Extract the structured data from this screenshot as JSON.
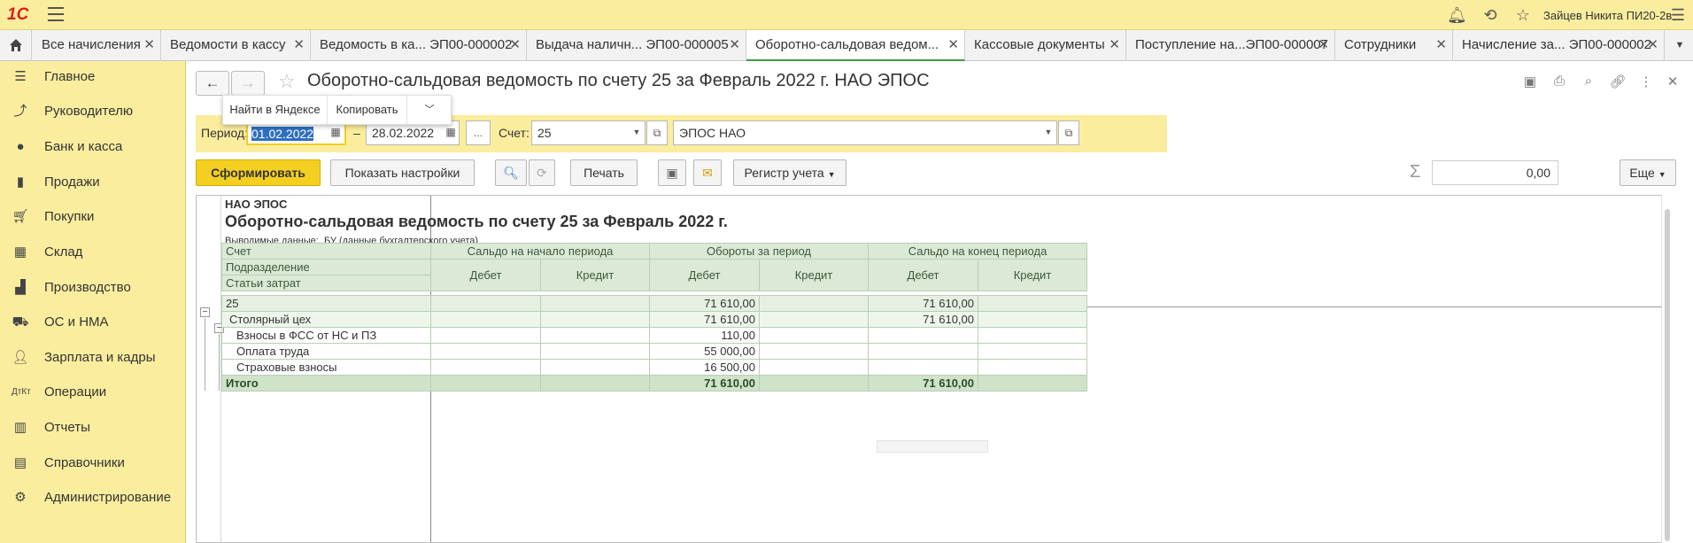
{
  "topbar": {
    "logo": "1С",
    "user": "Зайцев Никита ПИ20-2в"
  },
  "tabs": [
    {
      "label": "Все начисления"
    },
    {
      "label": "Ведомости в кассу"
    },
    {
      "label": "Ведомость в ка... ЭП00-000002"
    },
    {
      "label": "Выдача наличн... ЭП00-000005"
    },
    {
      "label": "Оборотно-сальдовая ведом..."
    },
    {
      "label": "Кассовые документы"
    },
    {
      "label": "Поступление на...ЭП00-000007"
    },
    {
      "label": "Сотрудники"
    },
    {
      "label": "Начисление за... ЭП00-000002"
    }
  ],
  "sidebar": {
    "items": [
      {
        "label": "Главное",
        "icon": "menu-icon"
      },
      {
        "label": "Руководителю",
        "icon": "trend-icon"
      },
      {
        "label": "Банк и касса",
        "icon": "coin-icon"
      },
      {
        "label": "Продажи",
        "icon": "bag-icon"
      },
      {
        "label": "Покупки",
        "icon": "cart-icon"
      },
      {
        "label": "Склад",
        "icon": "grid-icon"
      },
      {
        "label": "Производство",
        "icon": "factory-icon"
      },
      {
        "label": "ОС и НМА",
        "icon": "truck-icon"
      },
      {
        "label": "Зарплата и кадры",
        "icon": "person-icon"
      },
      {
        "label": "Операции",
        "icon": "dtkt-icon"
      },
      {
        "label": "Отчеты",
        "icon": "bar-chart-icon"
      },
      {
        "label": "Справочники",
        "icon": "books-icon"
      },
      {
        "label": "Администрирование",
        "icon": "gear-icon"
      }
    ]
  },
  "header": {
    "title": "Оборотно-сальдовая ведомость по счету 25 за Февраль 2022 г. НАО ЭПОС"
  },
  "popup": {
    "find": "Найти в Яндексе",
    "copy": "Копировать"
  },
  "filters": {
    "period_label": "Период:",
    "date_from": "01.02.2022",
    "dash": "–",
    "date_to": "28.02.2022",
    "dots": "...",
    "account_label": "Счет:",
    "account": "25",
    "org": "ЭПОС НАО"
  },
  "toolbar": {
    "generate": "Сформировать",
    "show_settings": "Показать настройки",
    "print": "Печать",
    "register": "Регистр учета",
    "sum": "0,00",
    "more": "Еще"
  },
  "report": {
    "org": "НАО ЭПОС",
    "title": "Оборотно-сальдовая ведомость по счету 25 за Февраль 2022 г.",
    "data_label": "Выводимые данные:",
    "data_value": "БУ (данные бухгалтерского учета)",
    "col_account": "Счет",
    "col_dept": "Подразделение",
    "col_costs": "Статьи затрат",
    "grp_open": "Сальдо на начало периода",
    "grp_turn": "Обороты за период",
    "grp_close": "Сальдо на конец периода",
    "debit": "Дебет",
    "credit": "Кредит",
    "rows": [
      {
        "name": "25",
        "od": "",
        "oc": "",
        "td": "71 610,00",
        "tc": "",
        "cd": "71 610,00",
        "cc": ""
      },
      {
        "name": "Столярный цех",
        "od": "",
        "oc": "",
        "td": "71 610,00",
        "tc": "",
        "cd": "71 610,00",
        "cc": ""
      },
      {
        "name": "Взносы в ФСС от НС и ПЗ",
        "od": "",
        "oc": "",
        "td": "110,00",
        "tc": "",
        "cd": "",
        "cc": ""
      },
      {
        "name": "Оплата труда",
        "od": "",
        "oc": "",
        "td": "55 000,00",
        "tc": "",
        "cd": "",
        "cc": ""
      },
      {
        "name": "Страховые взносы",
        "od": "",
        "oc": "",
        "td": "16 500,00",
        "tc": "",
        "cd": "",
        "cc": ""
      }
    ],
    "total": {
      "name": "Итого",
      "td": "71 610,00",
      "cd": "71 610,00"
    }
  }
}
